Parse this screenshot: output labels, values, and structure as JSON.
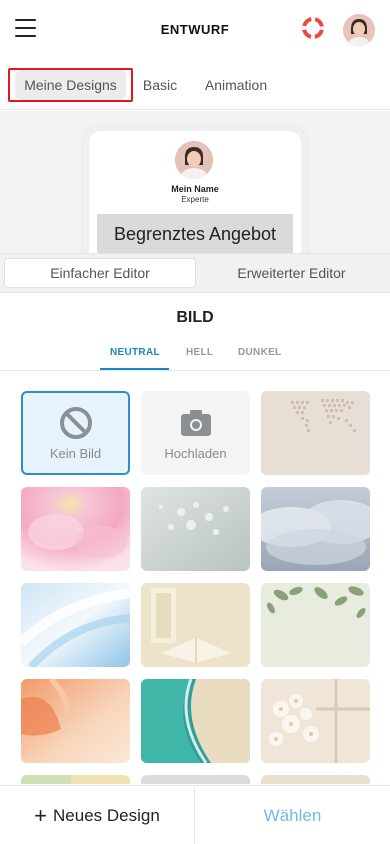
{
  "header": {
    "title": "ENTWURF",
    "menu_icon": "hamburger-menu-icon",
    "help_icon": "lifebuoy-icon",
    "avatar_icon": "user-avatar"
  },
  "top_tabs": [
    {
      "label": "Meine Designs",
      "active": true
    },
    {
      "label": "Basic",
      "active": false
    },
    {
      "label": "Animation",
      "active": false
    }
  ],
  "preview": {
    "name": "Mein Name",
    "role": "Experte",
    "banner_text": "Begrenztes Angebot"
  },
  "editor_tabs": [
    {
      "label": "Einfacher Editor",
      "active": true
    },
    {
      "label": "Erweiterter Editor",
      "active": false
    }
  ],
  "section": {
    "title": "BILD"
  },
  "filter_tabs": [
    {
      "label": "NEUTRAL",
      "active": true
    },
    {
      "label": "HELL",
      "active": false
    },
    {
      "label": "DUNKEL",
      "active": false
    }
  ],
  "tiles": {
    "none_label": "Kein Bild",
    "upload_label": "Hochladen"
  },
  "bottom": {
    "new_design_label": "Neues Design",
    "choose_label": "Wählen"
  },
  "colors": {
    "accent": "#1a86c9",
    "highlight_border": "#e1191e",
    "choose_text": "#72b9e4"
  }
}
